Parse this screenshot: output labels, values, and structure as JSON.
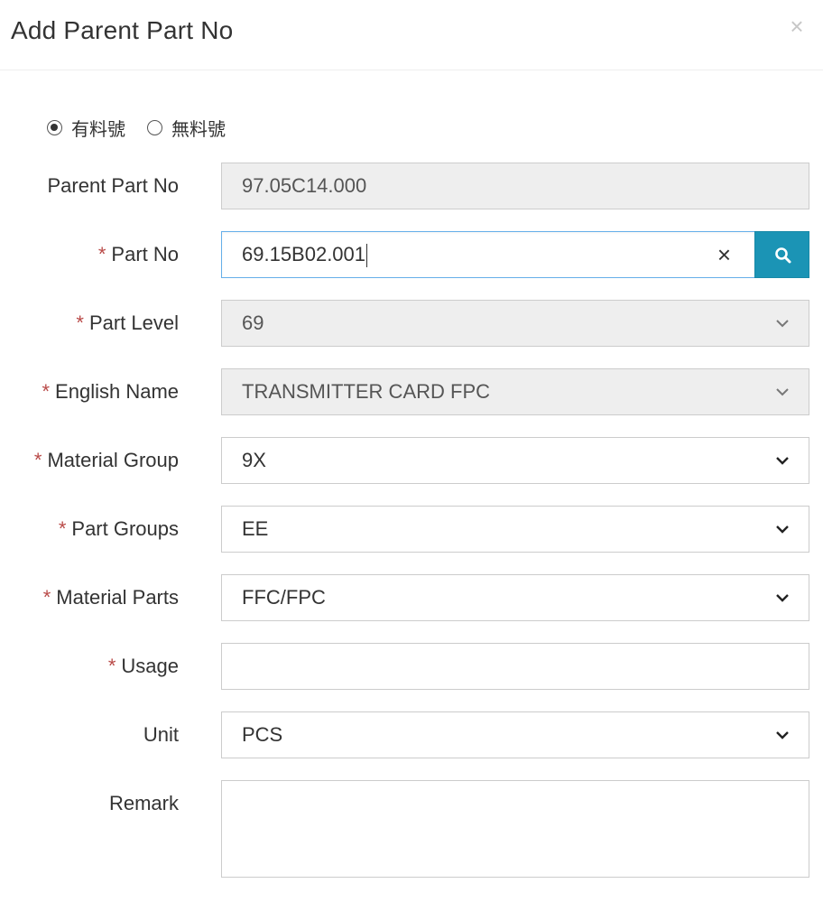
{
  "dialog": {
    "title": "Add Parent Part No",
    "close_glyph": "×"
  },
  "part_type": {
    "options": [
      {
        "label": "有料號",
        "checked": true
      },
      {
        "label": "無料號",
        "checked": false
      }
    ]
  },
  "form": {
    "required_mark": "*",
    "parent_part_no": {
      "label": "Parent Part No",
      "value": "97.05C14.000"
    },
    "part_no": {
      "label": "Part No",
      "value": "69.15B02.001",
      "clear_glyph": "×"
    },
    "part_level": {
      "label": "Part Level",
      "value": "69"
    },
    "english_name": {
      "label": "English Name",
      "value": "TRANSMITTER CARD FPC"
    },
    "material_group": {
      "label": "Material Group",
      "value": "9X"
    },
    "part_groups": {
      "label": "Part Groups",
      "value": "EE"
    },
    "material_parts": {
      "label": "Material Parts",
      "value": "FFC/FPC"
    },
    "usage": {
      "label": "Usage",
      "value": ""
    },
    "unit": {
      "label": "Unit",
      "value": "PCS"
    },
    "remark": {
      "label": "Remark",
      "value": ""
    }
  },
  "colors": {
    "accent": "#1b94b5",
    "required": "#b94a48",
    "disabled_bg": "#eeeeee"
  },
  "icons": {
    "search": "search-icon",
    "caret": "chevron-down-icon",
    "close": "close-icon"
  }
}
